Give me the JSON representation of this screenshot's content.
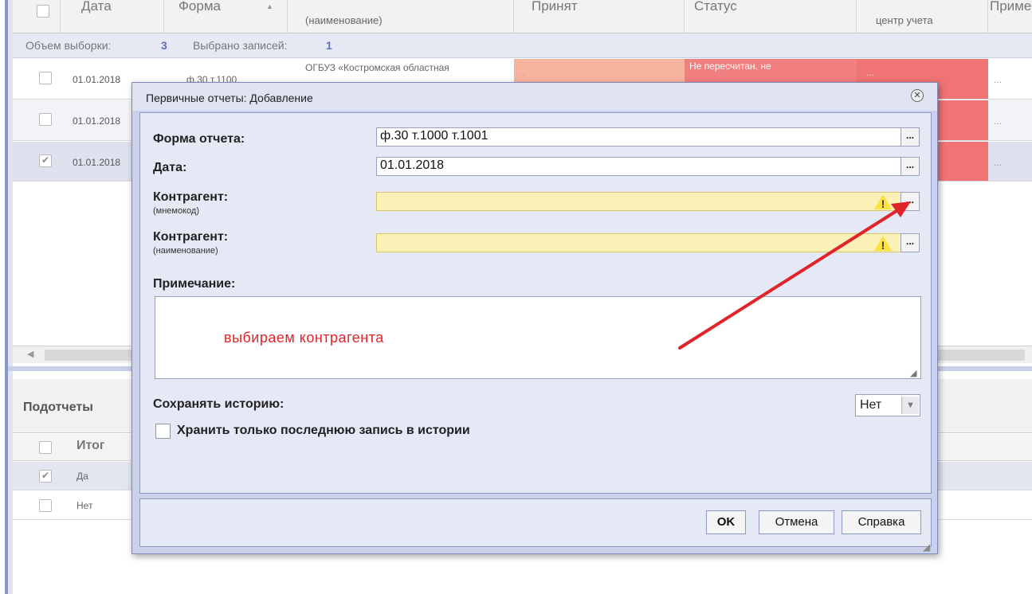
{
  "grid": {
    "headers": {
      "date": "Дата",
      "form": "Форма",
      "name_top": "(наименование)",
      "accepted": "Принят",
      "status": "Статус",
      "center": "центр учета",
      "note": "Приме"
    },
    "sample_label": "Объем выборки:",
    "sample_count": "3",
    "selected_label": "Выбрано записей:",
    "selected_count": "1",
    "rows": [
      {
        "date": "01.01.2018",
        "form": "ф.30 т.1100",
        "org": "ОГБУЗ «Костромская областная",
        "status": "Не пересчитан, не",
        "checked": false
      },
      {
        "date": "01.01.2018",
        "checked": false
      },
      {
        "date": "01.01.2018",
        "checked": true
      }
    ],
    "ellipsis": "..."
  },
  "subreports": {
    "title": "Подотчеты",
    "column": "Итог",
    "rows": [
      {
        "value": "Да",
        "checked": true
      },
      {
        "value": "Нет",
        "checked": false
      }
    ]
  },
  "dialog": {
    "title": "Первичные отчеты: Добавление",
    "close_icon": "close-icon",
    "fields": {
      "form_label": "Форма отчета:",
      "form_value": "ф.30 т.1000 т.1001",
      "date_label": "Дата:",
      "date_value": "01.01.2018",
      "contractor_code_label": "Контрагент:",
      "contractor_code_sub": "(мнемокод)",
      "contractor_name_label": "Контрагент:",
      "contractor_name_sub": "(наименование)",
      "browse_label": "...",
      "note_label": "Примечание:",
      "note_hint": "выбираем контрагента",
      "history_label": "Сохранять историю:",
      "history_value": "Нет",
      "last_only_label": "Хранить только последнюю запись в истории"
    },
    "buttons": {
      "ok": "OK",
      "cancel": "Отмена",
      "help": "Справка"
    },
    "colors": {
      "warning_field": "#fbf1b6",
      "annotation": "#e0242a",
      "dialog_frame": "#cbd1ea"
    }
  }
}
